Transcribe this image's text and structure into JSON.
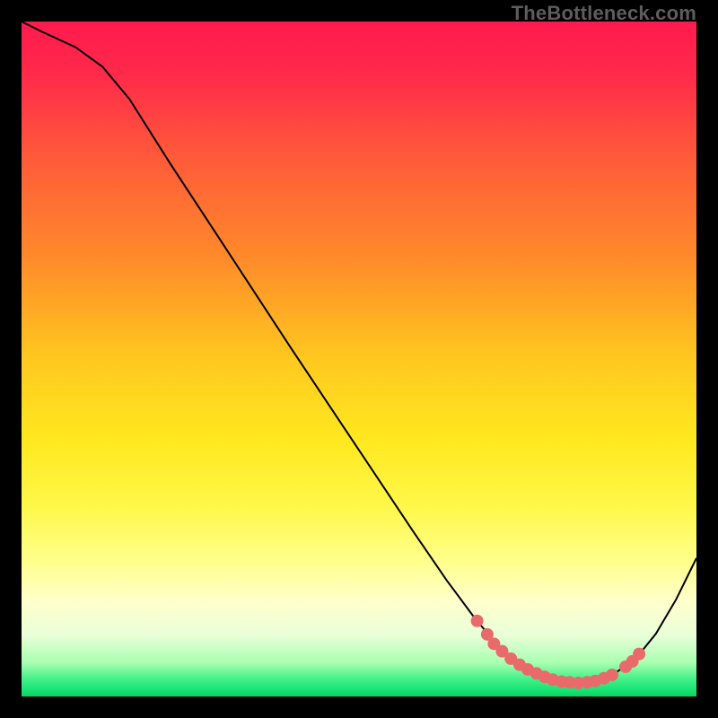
{
  "watermark": "TheBottleneck.com",
  "chart_data": {
    "type": "line",
    "title": "",
    "xlabel": "",
    "ylabel": "",
    "xlim": [
      0,
      100
    ],
    "ylim": [
      0,
      100
    ],
    "grid": false,
    "legend": false,
    "background": {
      "type": "vertical-gradient",
      "stops": [
        {
          "offset": 0.0,
          "color": "#ff1a4e"
        },
        {
          "offset": 0.08,
          "color": "#ff2a4a"
        },
        {
          "offset": 0.2,
          "color": "#ff5a3a"
        },
        {
          "offset": 0.35,
          "color": "#ff8a2a"
        },
        {
          "offset": 0.5,
          "color": "#ffc81f"
        },
        {
          "offset": 0.62,
          "color": "#ffe81f"
        },
        {
          "offset": 0.72,
          "color": "#fff84a"
        },
        {
          "offset": 0.8,
          "color": "#ffff8c"
        },
        {
          "offset": 0.86,
          "color": "#ffffcc"
        },
        {
          "offset": 0.91,
          "color": "#e8ffd8"
        },
        {
          "offset": 0.95,
          "color": "#a8ffb0"
        },
        {
          "offset": 0.975,
          "color": "#40f088"
        },
        {
          "offset": 1.0,
          "color": "#00d964"
        }
      ]
    },
    "curve": {
      "color": "#000000",
      "width": 2,
      "points": [
        {
          "x": 0.0,
          "y": 100.0
        },
        {
          "x": 3.0,
          "y": 98.5
        },
        {
          "x": 8.0,
          "y": 96.2
        },
        {
          "x": 12.0,
          "y": 93.3
        },
        {
          "x": 16.0,
          "y": 88.5
        },
        {
          "x": 22.0,
          "y": 79.0
        },
        {
          "x": 30.0,
          "y": 66.8
        },
        {
          "x": 40.0,
          "y": 51.5
        },
        {
          "x": 50.0,
          "y": 36.5
        },
        {
          "x": 58.0,
          "y": 24.5
        },
        {
          "x": 63.0,
          "y": 17.2
        },
        {
          "x": 67.0,
          "y": 11.8
        },
        {
          "x": 70.0,
          "y": 8.2
        },
        {
          "x": 73.0,
          "y": 5.2
        },
        {
          "x": 76.0,
          "y": 3.3
        },
        {
          "x": 79.0,
          "y": 2.3
        },
        {
          "x": 82.0,
          "y": 2.0
        },
        {
          "x": 85.0,
          "y": 2.4
        },
        {
          "x": 88.0,
          "y": 3.5
        },
        {
          "x": 91.0,
          "y": 5.6
        },
        {
          "x": 94.0,
          "y": 9.3
        },
        {
          "x": 97.0,
          "y": 14.4
        },
        {
          "x": 100.0,
          "y": 20.5
        }
      ]
    },
    "markers": {
      "color": "#e96a6a",
      "radius": 7,
      "points": [
        {
          "x": 67.5,
          "y": 11.2
        },
        {
          "x": 69.0,
          "y": 9.2
        },
        {
          "x": 70.0,
          "y": 7.8
        },
        {
          "x": 71.2,
          "y": 6.7
        },
        {
          "x": 72.5,
          "y": 5.6
        },
        {
          "x": 73.8,
          "y": 4.7
        },
        {
          "x": 75.0,
          "y": 4.0
        },
        {
          "x": 76.3,
          "y": 3.4
        },
        {
          "x": 77.5,
          "y": 2.9
        },
        {
          "x": 78.7,
          "y": 2.5
        },
        {
          "x": 80.0,
          "y": 2.2
        },
        {
          "x": 81.2,
          "y": 2.1
        },
        {
          "x": 82.5,
          "y": 2.0
        },
        {
          "x": 83.8,
          "y": 2.1
        },
        {
          "x": 85.0,
          "y": 2.3
        },
        {
          "x": 86.3,
          "y": 2.7
        },
        {
          "x": 87.5,
          "y": 3.2
        },
        {
          "x": 89.5,
          "y": 4.4
        },
        {
          "x": 90.5,
          "y": 5.2
        },
        {
          "x": 91.5,
          "y": 6.3
        }
      ]
    }
  }
}
